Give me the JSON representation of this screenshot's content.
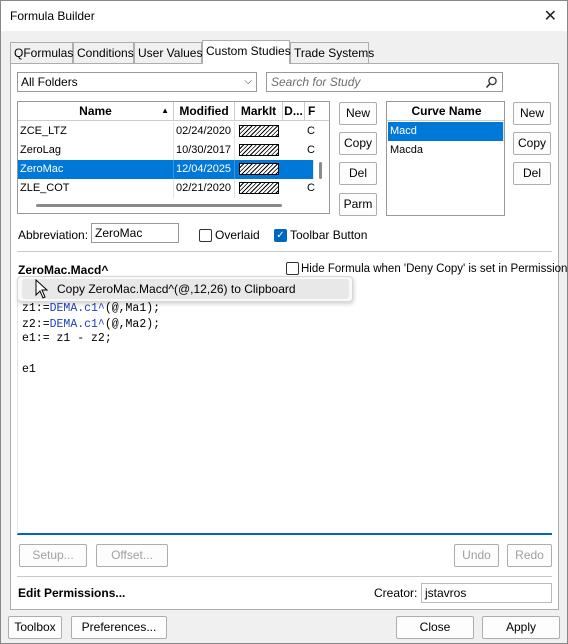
{
  "window": {
    "title": "Formula Builder"
  },
  "tabs": [
    "QFormulas",
    "Conditions",
    "User Values",
    "Custom Studies",
    "Trade Systems"
  ],
  "folder_select": {
    "value": "All Folders"
  },
  "search": {
    "placeholder": "Search for Study"
  },
  "studies_table": {
    "headers": [
      "Name",
      "Modified",
      "MarkIt",
      "D...",
      "F"
    ],
    "rows": [
      {
        "name": "ZCE_LTZ",
        "modified": "02/24/2020",
        "f": "C"
      },
      {
        "name": "ZeroLag",
        "modified": "10/30/2017",
        "f": "C"
      },
      {
        "name": "ZeroMac",
        "modified": "12/04/2025",
        "f": ""
      },
      {
        "name": "ZLE_COT",
        "modified": "02/21/2020",
        "f": "C"
      }
    ],
    "selected_index": 2
  },
  "study_buttons": {
    "new": "New",
    "copy": "Copy",
    "del": "Del",
    "parm": "Parm"
  },
  "curve_table": {
    "header": "Curve Name",
    "rows": [
      "Macd",
      "Macda"
    ],
    "selected_index": 0
  },
  "curve_buttons": {
    "new": "New",
    "copy": "Copy",
    "del": "Del"
  },
  "abbreviation": {
    "label": "Abbreviation:",
    "value": "ZeroMac"
  },
  "overlaid": {
    "label": "Overlaid",
    "checked": false
  },
  "toolbar_button": {
    "label": "Toolbar Button",
    "checked": true
  },
  "formula_name": "ZeroMac.Macd^",
  "hide_formula": {
    "label": "Hide Formula when 'Deny Copy' is set in Permissions",
    "checked": false
  },
  "context_menu": {
    "item": "Copy ZeroMac.Macd^(@,12,26) to Clipboard"
  },
  "code": {
    "line1": {
      "var": "z1:=",
      "fn": "DEMA.c1^",
      "args": "(@,Ma1);"
    },
    "line2": {
      "var": "z2:=",
      "fn": "DEMA.c1^",
      "args": "(@,Ma2);"
    },
    "line3": "e1:= z1 - z2;",
    "line4": "e1"
  },
  "editor_buttons": {
    "setup": "Setup...",
    "offset": "Offset...",
    "undo": "Undo",
    "redo": "Redo"
  },
  "edit_permissions": "Edit Permissions...",
  "creator": {
    "label": "Creator:",
    "value": "jstavros"
  },
  "footer_buttons": {
    "toolbox": "Toolbox",
    "preferences": "Preferences...",
    "close": "Close",
    "apply": "Apply"
  },
  "colors": {
    "selection": "#0078d7",
    "accent": "#0067c0"
  }
}
